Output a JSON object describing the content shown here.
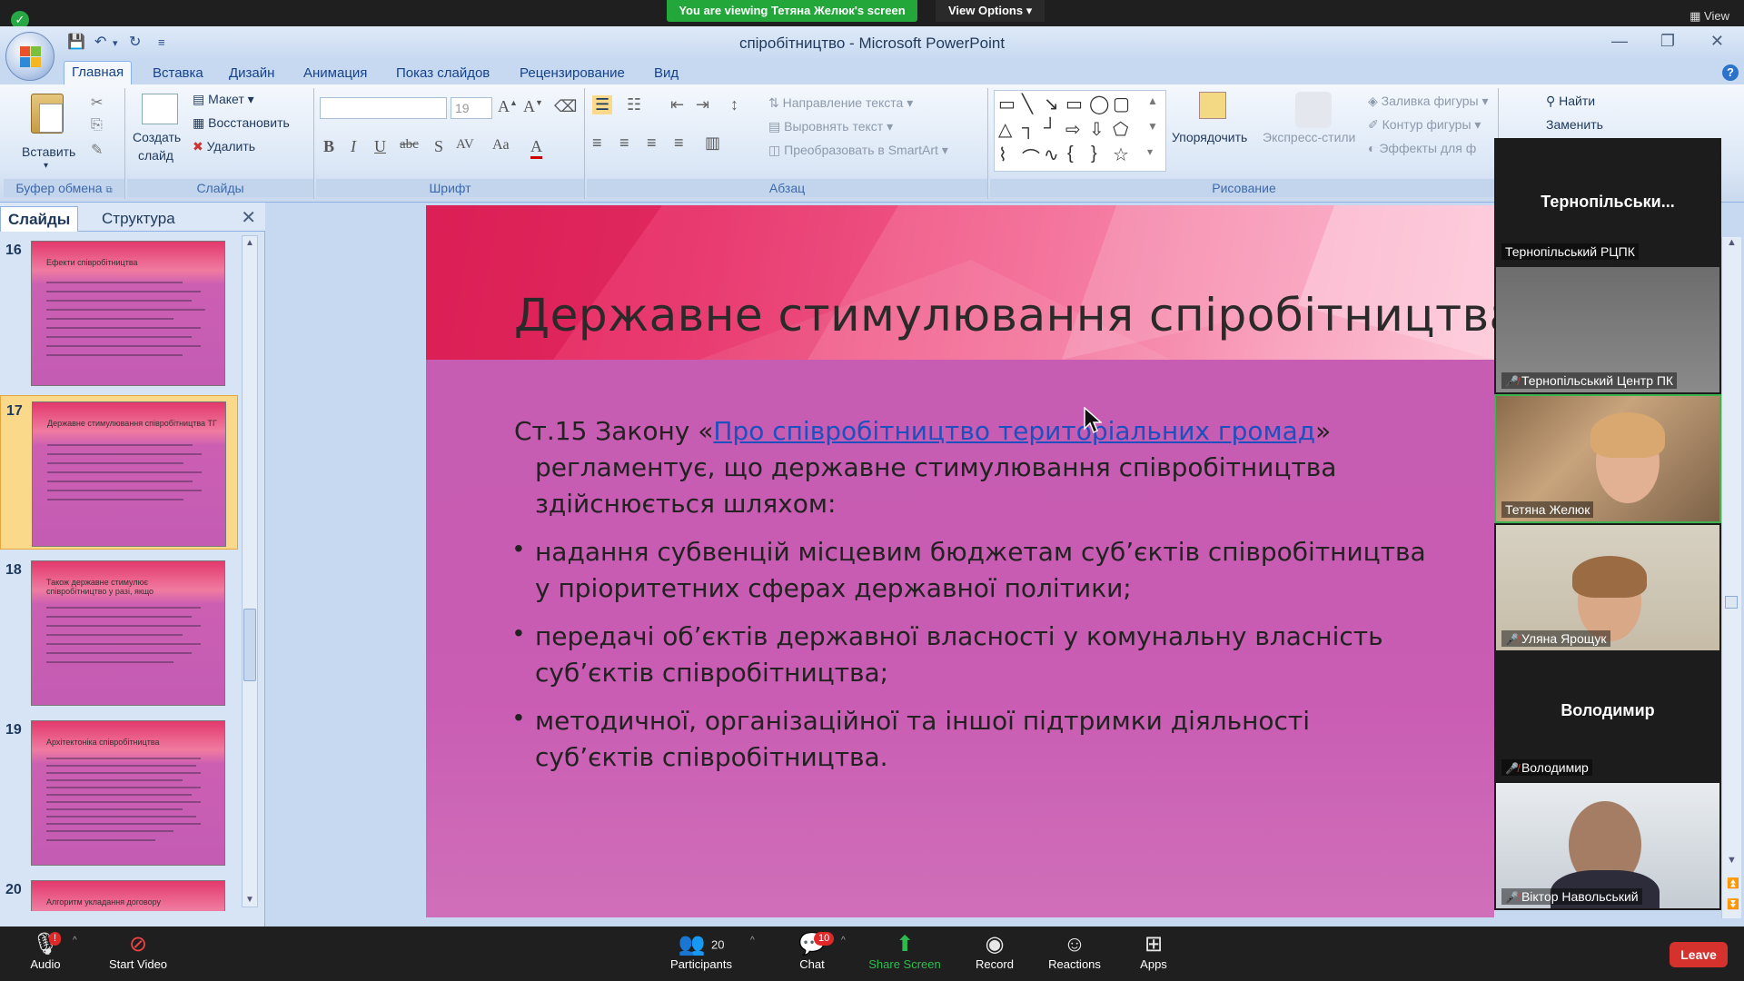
{
  "zoom": {
    "viewing_banner": "You are viewing Тетяна Желюк's screen",
    "view_options": "View Options",
    "view_button": "View",
    "toolbar": {
      "audio": "Audio",
      "audio_badge": "!",
      "start_video": "Start Video",
      "participants": "Participants",
      "participants_count": "20",
      "chat": "Chat",
      "chat_badge": "10",
      "share_screen": "Share Screen",
      "record": "Record",
      "reactions": "Reactions",
      "apps": "Apps",
      "leave": "Leave"
    },
    "gallery": [
      {
        "big_name": "Тернопільськи...",
        "label": "Тернопільський РЦПК",
        "video": false,
        "muted": false
      },
      {
        "big_name": "",
        "label": "Тернопільський Центр ПК",
        "video": true,
        "muted": true
      },
      {
        "big_name": "",
        "label": "Тетяна Желюк",
        "video": true,
        "muted": false,
        "active": true
      },
      {
        "big_name": "",
        "label": "Уляна Ярощук",
        "video": true,
        "muted": true
      },
      {
        "big_name": "Володимир",
        "label": "Володимир",
        "video": false,
        "muted": true
      },
      {
        "big_name": "",
        "label": "Віктор Навольський",
        "video": true,
        "muted": true
      }
    ]
  },
  "ppt": {
    "window_title": "спіробітництво - Microsoft PowerPoint",
    "tabs": [
      "Главная",
      "Вставка",
      "Дизайн",
      "Анимация",
      "Показ слайдов",
      "Рецензирование",
      "Вид"
    ],
    "ribbon": {
      "clipboard": {
        "label": "Буфер обмена",
        "paste": "Вставить"
      },
      "slides": {
        "label": "Слайды",
        "create": "Создать",
        "create2": "слайд",
        "layout": "Макет",
        "reset": "Восстановить",
        "delete": "Удалить"
      },
      "font": {
        "label": "Шрифт",
        "size": "19"
      },
      "paragraph": {
        "label": "Абзац",
        "text_dir": "Направление текста",
        "align_text": "Выровнять текст",
        "smartart": "Преобразовать в SmartArt"
      },
      "drawing": {
        "label": "Рисование",
        "arrange": "Упорядочить",
        "quick_styles": "Экспресс-стили",
        "fill": "Заливка фигуры",
        "outline": "Контур фигуры",
        "effects": "Эффекты для ф"
      },
      "editing": {
        "find": "Найти",
        "replace": "Заменить"
      }
    },
    "left_panel": {
      "tab_slides": "Слайды",
      "tab_outline": "Структура",
      "thumbs": [
        {
          "num": "16",
          "title": "Ефекти співробітництва"
        },
        {
          "num": "17",
          "title": "Державне стимулювання співробітництва ТГ",
          "selected": true
        },
        {
          "num": "18",
          "title": "Також державне стимулює співробітництво у разі, якщо"
        },
        {
          "num": "19",
          "title": "Архітектоніка співробітництва"
        },
        {
          "num": "20",
          "title": "Алгоритм укладання договору"
        }
      ]
    },
    "slide": {
      "title": "Державне стимулювання спіробітництва ТГ",
      "intro_prefix": "Ст.15 Закону «",
      "intro_link": "Про співробітництво територіальних громад",
      "intro_suffix": "»",
      "intro_line2": "регламентує, що державне стимулювання співробітництва",
      "intro_line3": "здійснюється шляхом:",
      "bullets": [
        [
          "надання субвенцій місцевим бюджетам суб’єктів співробітництва",
          "у пріоритетних сферах державної політики;"
        ],
        [
          "передачі об’єктів державної власності у комунальну власність",
          "суб’єктів співробітництва;"
        ],
        [
          "методичної, організаційної та іншої підтримки діяльності",
          "суб’єктів співробітництва."
        ]
      ]
    }
  }
}
